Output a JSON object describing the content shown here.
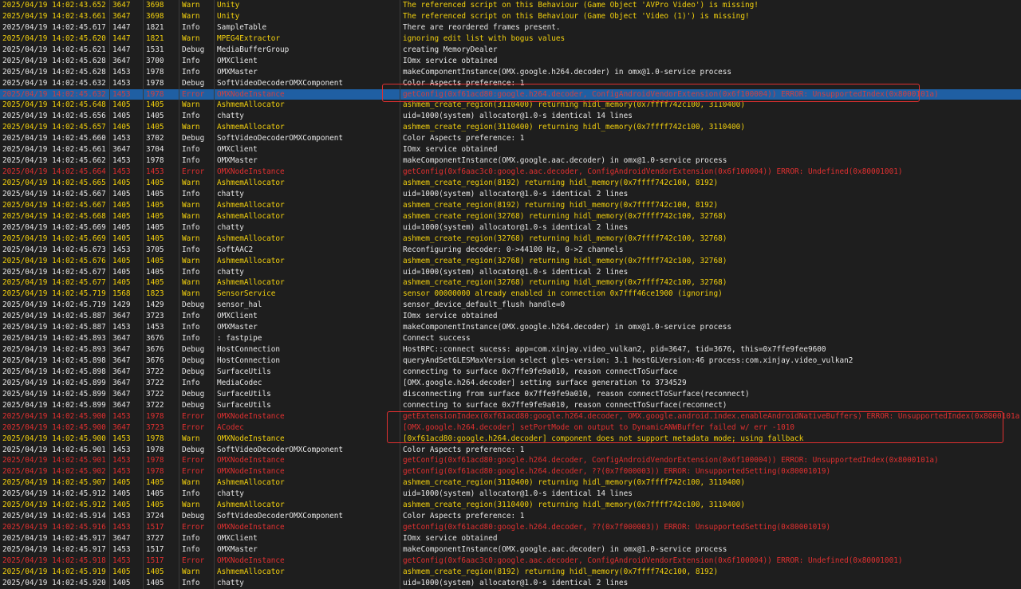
{
  "log": {
    "rows": [
      {
        "t": "2025/04/19 14:02:43.652",
        "pid": "3647",
        "tid": "3698",
        "lvl": "Warn",
        "tag": "Unity",
        "msg": "The referenced script on this Behaviour (Game Object 'AVPro Video') is missing!"
      },
      {
        "t": "2025/04/19 14:02:43.661",
        "pid": "3647",
        "tid": "3698",
        "lvl": "Warn",
        "tag": "Unity",
        "msg": "The referenced script on this Behaviour (Game Object 'Video (1)') is missing!"
      },
      {
        "t": "2025/04/19 14:02:45.617",
        "pid": "1447",
        "tid": "1821",
        "lvl": "Info",
        "tag": "SampleTable",
        "msg": "There are reordered frames present."
      },
      {
        "t": "2025/04/19 14:02:45.620",
        "pid": "1447",
        "tid": "1821",
        "lvl": "Warn",
        "tag": "MPEG4Extractor",
        "msg": "ignoring edit list with bogus values"
      },
      {
        "t": "2025/04/19 14:02:45.621",
        "pid": "1447",
        "tid": "1531",
        "lvl": "Debug",
        "tag": "MediaBufferGroup",
        "msg": "creating MemoryDealer"
      },
      {
        "t": "2025/04/19 14:02:45.628",
        "pid": "3647",
        "tid": "3700",
        "lvl": "Info",
        "tag": "OMXClient",
        "msg": "IOmx service obtained"
      },
      {
        "t": "2025/04/19 14:02:45.628",
        "pid": "1453",
        "tid": "1978",
        "lvl": "Info",
        "tag": "OMXMaster",
        "msg": "makeComponentInstance(OMX.google.h264.decoder) in omx@1.0-service process"
      },
      {
        "t": "2025/04/19 14:02:45.632",
        "pid": "1453",
        "tid": "1978",
        "lvl": "Debug",
        "tag": "SoftVideoDecoderOMXComponent",
        "msg": "Color Aspects preference: 1"
      },
      {
        "t": "2025/04/19 14:02:45.632",
        "pid": "1453",
        "tid": "1978",
        "lvl": "Error",
        "tag": "OMXNodeInstance",
        "msg": "getConfig(0xf61acd80:google.h264.decoder, ConfigAndroidVendorExtension(0x6f100004)) ERROR: UnsupportedIndex(0x8000101a)",
        "selected": true
      },
      {
        "t": "2025/04/19 14:02:45.648",
        "pid": "1405",
        "tid": "1405",
        "lvl": "Warn",
        "tag": "AshmemAllocator",
        "msg": "ashmem_create_region(3110400) returning hidl_memory(0x7ffff742c100, 3110400)"
      },
      {
        "t": "2025/04/19 14:02:45.656",
        "pid": "1405",
        "tid": "1405",
        "lvl": "Info",
        "tag": "chatty",
        "msg": "uid=1000(system) allocator@1.0-s identical 14 lines"
      },
      {
        "t": "2025/04/19 14:02:45.657",
        "pid": "1405",
        "tid": "1405",
        "lvl": "Warn",
        "tag": "AshmemAllocator",
        "msg": "ashmem_create_region(3110400) returning hidl_memory(0x7ffff742c100, 3110400)"
      },
      {
        "t": "2025/04/19 14:02:45.660",
        "pid": "1453",
        "tid": "3702",
        "lvl": "Debug",
        "tag": "SoftVideoDecoderOMXComponent",
        "msg": "Color Aspects preference: 1"
      },
      {
        "t": "2025/04/19 14:02:45.661",
        "pid": "3647",
        "tid": "3704",
        "lvl": "Info",
        "tag": "OMXClient",
        "msg": "IOmx service obtained"
      },
      {
        "t": "2025/04/19 14:02:45.662",
        "pid": "1453",
        "tid": "1978",
        "lvl": "Info",
        "tag": "OMXMaster",
        "msg": "makeComponentInstance(OMX.google.aac.decoder) in omx@1.0-service process"
      },
      {
        "t": "2025/04/19 14:02:45.664",
        "pid": "1453",
        "tid": "1453",
        "lvl": "Error",
        "tag": "OMXNodeInstance",
        "msg": "getConfig(0xf6aac3c0:google.aac.decoder, ConfigAndroidVendorExtension(0x6f100004)) ERROR: Undefined(0x80001001)"
      },
      {
        "t": "2025/04/19 14:02:45.665",
        "pid": "1405",
        "tid": "1405",
        "lvl": "Warn",
        "tag": "AshmemAllocator",
        "msg": "ashmem_create_region(8192) returning hidl_memory(0x7ffff742c100, 8192)"
      },
      {
        "t": "2025/04/19 14:02:45.667",
        "pid": "1405",
        "tid": "1405",
        "lvl": "Info",
        "tag": "chatty",
        "msg": "uid=1000(system) allocator@1.0-s identical 2 lines"
      },
      {
        "t": "2025/04/19 14:02:45.667",
        "pid": "1405",
        "tid": "1405",
        "lvl": "Warn",
        "tag": "AshmemAllocator",
        "msg": "ashmem_create_region(8192) returning hidl_memory(0x7ffff742c100, 8192)"
      },
      {
        "t": "2025/04/19 14:02:45.668",
        "pid": "1405",
        "tid": "1405",
        "lvl": "Warn",
        "tag": "AshmemAllocator",
        "msg": "ashmem_create_region(32768) returning hidl_memory(0x7ffff742c100, 32768)"
      },
      {
        "t": "2025/04/19 14:02:45.669",
        "pid": "1405",
        "tid": "1405",
        "lvl": "Info",
        "tag": "chatty",
        "msg": "uid=1000(system) allocator@1.0-s identical 2 lines"
      },
      {
        "t": "2025/04/19 14:02:45.669",
        "pid": "1405",
        "tid": "1405",
        "lvl": "Warn",
        "tag": "AshmemAllocator",
        "msg": "ashmem_create_region(32768) returning hidl_memory(0x7ffff742c100, 32768)"
      },
      {
        "t": "2025/04/19 14:02:45.673",
        "pid": "1453",
        "tid": "3705",
        "lvl": "Info",
        "tag": "SoftAAC2",
        "msg": "Reconfiguring decoder: 0->44100 Hz, 0->2 channels"
      },
      {
        "t": "2025/04/19 14:02:45.676",
        "pid": "1405",
        "tid": "1405",
        "lvl": "Warn",
        "tag": "AshmemAllocator",
        "msg": "ashmem_create_region(32768) returning hidl_memory(0x7ffff742c100, 32768)"
      },
      {
        "t": "2025/04/19 14:02:45.677",
        "pid": "1405",
        "tid": "1405",
        "lvl": "Info",
        "tag": "chatty",
        "msg": "uid=1000(system) allocator@1.0-s identical 2 lines"
      },
      {
        "t": "2025/04/19 14:02:45.677",
        "pid": "1405",
        "tid": "1405",
        "lvl": "Warn",
        "tag": "AshmemAllocator",
        "msg": "ashmem_create_region(32768) returning hidl_memory(0x7ffff742c100, 32768)"
      },
      {
        "t": "2025/04/19 14:02:45.719",
        "pid": "1568",
        "tid": "1823",
        "lvl": "Warn",
        "tag": "SensorService",
        "msg": "sensor 00000000 already enabled in connection 0x7fff46ce1900 (ignoring)"
      },
      {
        "t": "2025/04/19 14:02:45.719",
        "pid": "1429",
        "tid": "1429",
        "lvl": "Debug",
        "tag": "sensor_hal",
        "msg": "sensor_device_default_flush handle=0"
      },
      {
        "t": "2025/04/19 14:02:45.887",
        "pid": "3647",
        "tid": "3723",
        "lvl": "Info",
        "tag": "OMXClient",
        "msg": "IOmx service obtained"
      },
      {
        "t": "2025/04/19 14:02:45.887",
        "pid": "1453",
        "tid": "1453",
        "lvl": "Info",
        "tag": "OMXMaster",
        "msg": "makeComponentInstance(OMX.google.h264.decoder) in omx@1.0-service process"
      },
      {
        "t": "2025/04/19 14:02:45.893",
        "pid": "3647",
        "tid": "3676",
        "lvl": "Info",
        "tag": ": fastpipe",
        "msg": "Connect success"
      },
      {
        "t": "2025/04/19 14:02:45.893",
        "pid": "3647",
        "tid": "3676",
        "lvl": "Debug",
        "tag": "HostConnection",
        "msg": "HostRPC::connect sucess: app=com.xinjay.video_vulkan2, pid=3647, tid=3676, this=0x7ffe9fee9600"
      },
      {
        "t": "2025/04/19 14:02:45.898",
        "pid": "3647",
        "tid": "3676",
        "lvl": "Debug",
        "tag": "HostConnection",
        "msg": "queryAndSetGLESMaxVersion select gles-version: 3.1 hostGLVersion:46 process:com.xinjay.video_vulkan2"
      },
      {
        "t": "2025/04/19 14:02:45.898",
        "pid": "3647",
        "tid": "3722",
        "lvl": "Debug",
        "tag": "SurfaceUtils",
        "msg": "connecting to surface 0x7ffe9fe9a010, reason connectToSurface"
      },
      {
        "t": "2025/04/19 14:02:45.899",
        "pid": "3647",
        "tid": "3722",
        "lvl": "Info",
        "tag": "MediaCodec",
        "msg": "[OMX.google.h264.decoder] setting surface generation to 3734529"
      },
      {
        "t": "2025/04/19 14:02:45.899",
        "pid": "3647",
        "tid": "3722",
        "lvl": "Debug",
        "tag": "SurfaceUtils",
        "msg": "disconnecting from surface 0x7ffe9fe9a010, reason connectToSurface(reconnect)"
      },
      {
        "t": "2025/04/19 14:02:45.899",
        "pid": "3647",
        "tid": "3722",
        "lvl": "Debug",
        "tag": "SurfaceUtils",
        "msg": "connecting to surface 0x7ffe9fe9a010, reason connectToSurface(reconnect)"
      },
      {
        "t": "2025/04/19 14:02:45.900",
        "pid": "1453",
        "tid": "1978",
        "lvl": "Error",
        "tag": "OMXNodeInstance",
        "msg": "getExtensionIndex(0xf61acd80:google.h264.decoder, OMX.google.android.index.enableAndroidNativeBuffers) ERROR: UnsupportedIndex(0x8000101a)"
      },
      {
        "t": "2025/04/19 14:02:45.900",
        "pid": "3647",
        "tid": "3723",
        "lvl": "Error",
        "tag": "ACodec",
        "msg": "[OMX.google.h264.decoder] setPortMode on output to DynamicANWBuffer failed w/ err -1010"
      },
      {
        "t": "2025/04/19 14:02:45.900",
        "pid": "1453",
        "tid": "1978",
        "lvl": "Warn",
        "tag": "OMXNodeInstance",
        "msg": "[0xf61acd80:google.h264.decoder] component does not support metadata mode; using fallback"
      },
      {
        "t": "2025/04/19 14:02:45.901",
        "pid": "1453",
        "tid": "1978",
        "lvl": "Debug",
        "tag": "SoftVideoDecoderOMXComponent",
        "msg": "Color Aspects preference: 1"
      },
      {
        "t": "2025/04/19 14:02:45.901",
        "pid": "1453",
        "tid": "1978",
        "lvl": "Error",
        "tag": "OMXNodeInstance",
        "msg": "getConfig(0xf61acd80:google.h264.decoder, ConfigAndroidVendorExtension(0x6f100004)) ERROR: UnsupportedIndex(0x8000101a)"
      },
      {
        "t": "2025/04/19 14:02:45.902",
        "pid": "1453",
        "tid": "1978",
        "lvl": "Error",
        "tag": "OMXNodeInstance",
        "msg": "getConfig(0xf61acd80:google.h264.decoder, ??(0x7f000003)) ERROR: UnsupportedSetting(0x80001019)"
      },
      {
        "t": "2025/04/19 14:02:45.907",
        "pid": "1405",
        "tid": "1405",
        "lvl": "Warn",
        "tag": "AshmemAllocator",
        "msg": "ashmem_create_region(3110400) returning hidl_memory(0x7ffff742c100, 3110400)"
      },
      {
        "t": "2025/04/19 14:02:45.912",
        "pid": "1405",
        "tid": "1405",
        "lvl": "Info",
        "tag": "chatty",
        "msg": "uid=1000(system) allocator@1.0-s identical 14 lines"
      },
      {
        "t": "2025/04/19 14:02:45.912",
        "pid": "1405",
        "tid": "1405",
        "lvl": "Warn",
        "tag": "AshmemAllocator",
        "msg": "ashmem_create_region(3110400) returning hidl_memory(0x7ffff742c100, 3110400)"
      },
      {
        "t": "2025/04/19 14:02:45.914",
        "pid": "1453",
        "tid": "3724",
        "lvl": "Debug",
        "tag": "SoftVideoDecoderOMXComponent",
        "msg": "Color Aspects preference: 1"
      },
      {
        "t": "2025/04/19 14:02:45.916",
        "pid": "1453",
        "tid": "1517",
        "lvl": "Error",
        "tag": "OMXNodeInstance",
        "msg": "getConfig(0xf61acd80:google.h264.decoder, ??(0x7f000003)) ERROR: UnsupportedSetting(0x80001019)"
      },
      {
        "t": "2025/04/19 14:02:45.917",
        "pid": "3647",
        "tid": "3727",
        "lvl": "Info",
        "tag": "OMXClient",
        "msg": "IOmx service obtained"
      },
      {
        "t": "2025/04/19 14:02:45.917",
        "pid": "1453",
        "tid": "1517",
        "lvl": "Info",
        "tag": "OMXMaster",
        "msg": "makeComponentInstance(OMX.google.aac.decoder) in omx@1.0-service process"
      },
      {
        "t": "2025/04/19 14:02:45.918",
        "pid": "1453",
        "tid": "1517",
        "lvl": "Error",
        "tag": "OMXNodeInstance",
        "msg": "getConfig(0xf6aac3c0:google.aac.decoder, ConfigAndroidVendorExtension(0x6f100004)) ERROR: Undefined(0x80001001)"
      },
      {
        "t": "2025/04/19 14:02:45.919",
        "pid": "1405",
        "tid": "1405",
        "lvl": "Warn",
        "tag": "AshmemAllocator",
        "msg": "ashmem_create_region(8192) returning hidl_memory(0x7ffff742c100, 8192)"
      },
      {
        "t": "2025/04/19 14:02:45.920",
        "pid": "1405",
        "tid": "1405",
        "lvl": "Info",
        "tag": "chatty",
        "msg": "uid=1000(system) allocator@1.0-s identical 2 lines"
      }
    ]
  },
  "colors": {
    "background": "#1e1e1e",
    "selected_row": "#1f5fa3",
    "warn": "#f2d00e",
    "error": "#e03030",
    "info": "#e6e6e6"
  }
}
